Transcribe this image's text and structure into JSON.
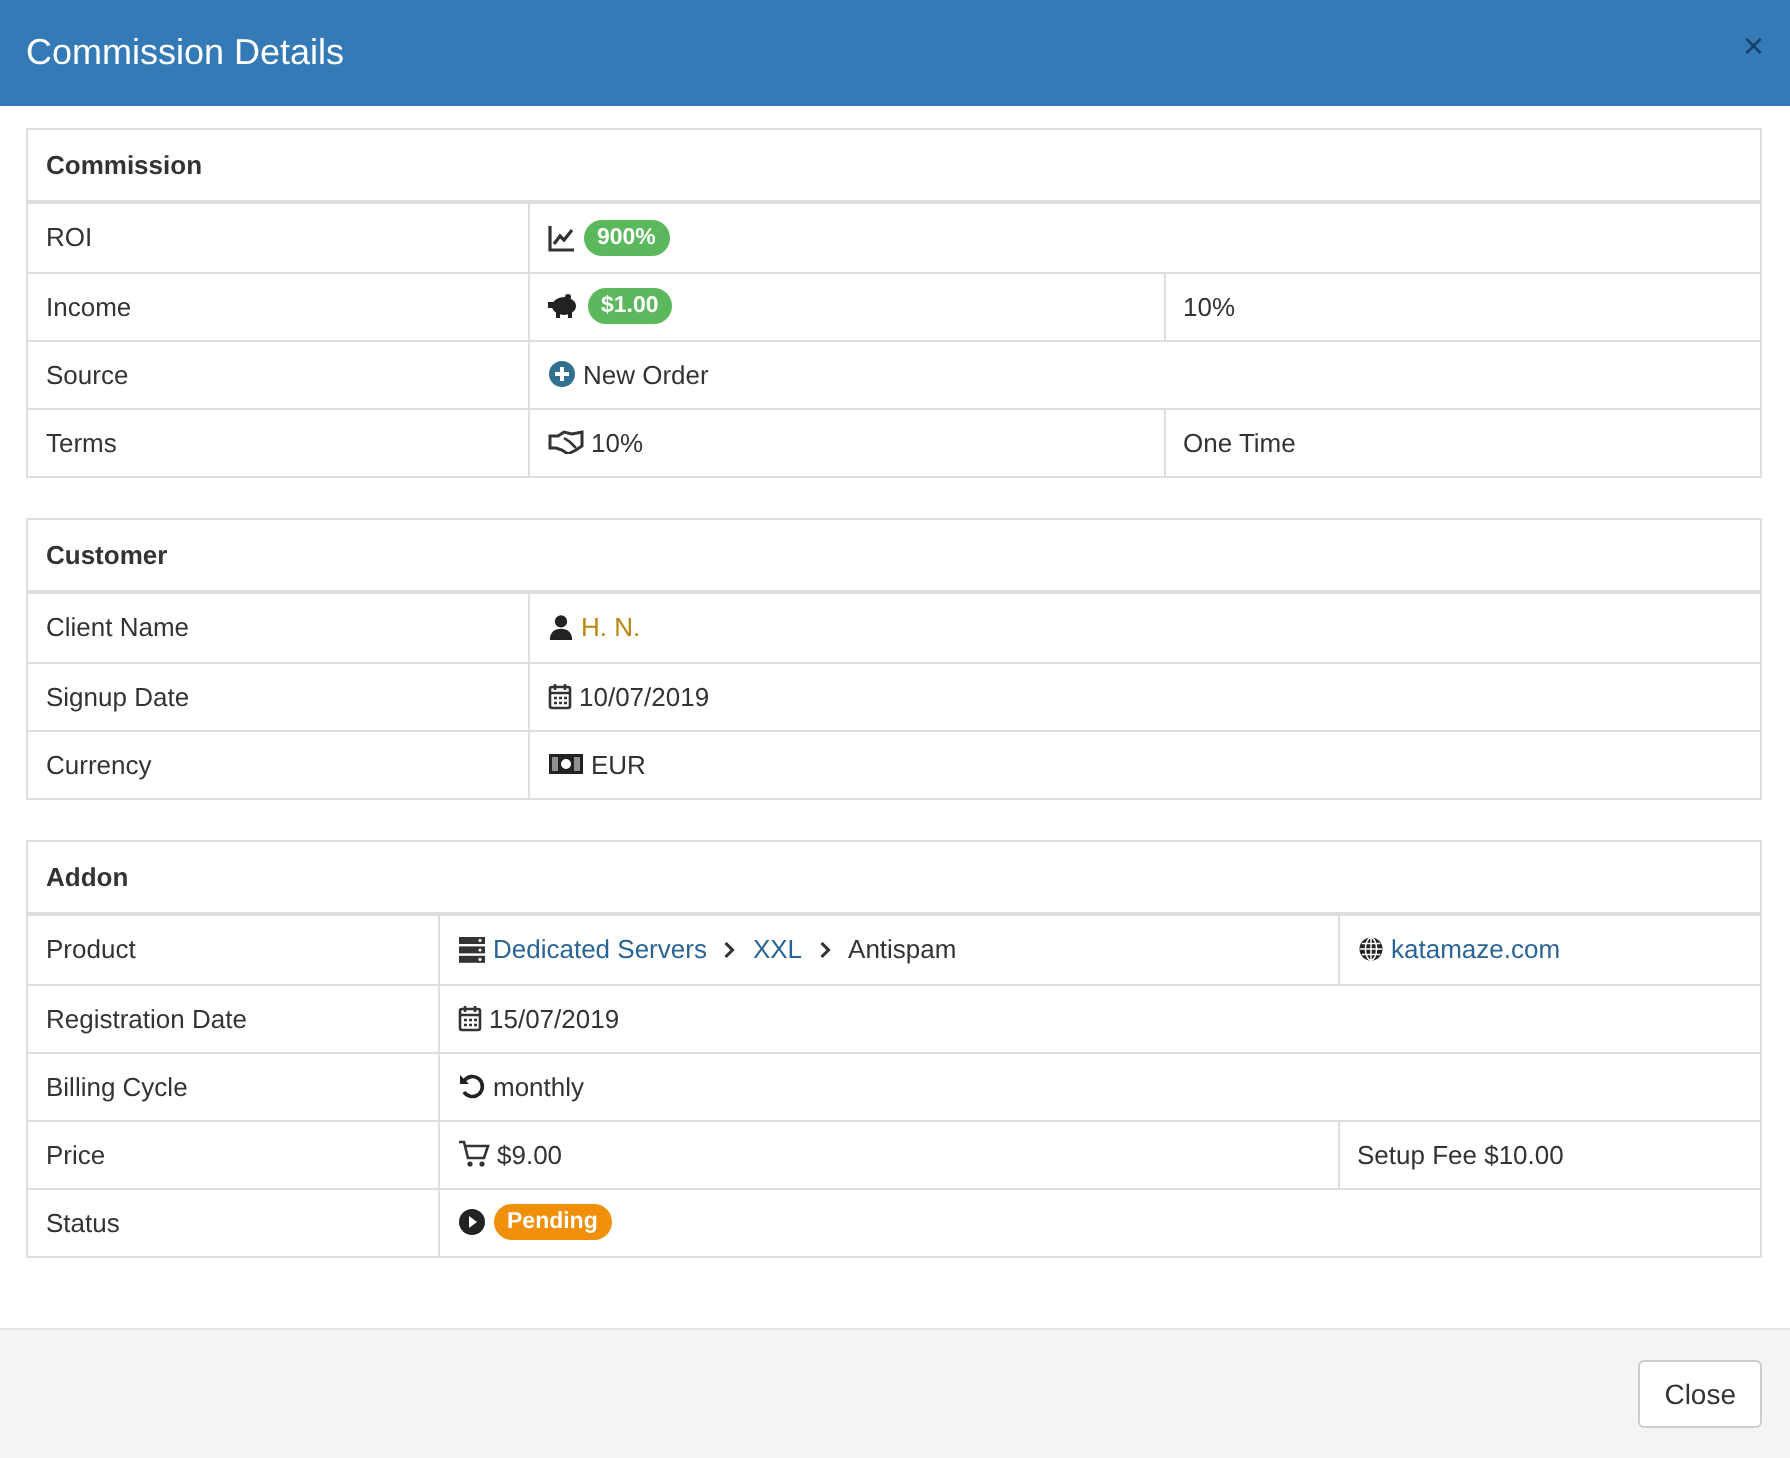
{
  "modal": {
    "title": "Commission Details",
    "close_glyph": "×"
  },
  "sections": [
    {
      "title": "Commission",
      "rows": [
        {
          "label": "ROI",
          "cells": [
            {
              "colspan": 2,
              "parts": [
                {
                  "kind": "badge",
                  "text": "900%",
                  "color": "#5cb85c"
                }
              ]
            }
          ]
        },
        {
          "label": "Income",
          "cells": [
            {
              "parts": [
                {
                  "kind": "badge",
                  "text": "$1.00",
                  "color": "#5cb85c"
                }
              ]
            },
            {
              "parts": [
                {
                  "kind": "text",
                  "text": "10%"
                }
              ]
            }
          ]
        },
        {
          "label": "Source",
          "cells": [
            {
              "colspan": 2,
              "parts": [
                {
                  "kind": "text",
                  "text": "New Order"
                }
              ]
            }
          ]
        },
        {
          "label": "Terms",
          "cells": [
            {
              "parts": [
                {
                  "kind": "text",
                  "text": "10%"
                }
              ]
            },
            {
              "parts": [
                {
                  "kind": "text",
                  "text": "One Time"
                }
              ]
            }
          ]
        }
      ]
    },
    {
      "title": "Customer",
      "rows": [
        {
          "label": "Client Name",
          "cells": [
            {
              "colspan": 2,
              "parts": [
                {
                  "kind": "link",
                  "text": "H. N.",
                  "color": "#b8860b"
                }
              ]
            }
          ]
        },
        {
          "label": "Signup Date",
          "cells": [
            {
              "colspan": 2,
              "parts": [
                {
                  "kind": "text",
                  "text": "10/07/2019"
                }
              ]
            }
          ]
        },
        {
          "label": "Currency",
          "cells": [
            {
              "colspan": 2,
              "parts": [
                {
                  "kind": "text",
                  "text": "EUR"
                }
              ]
            }
          ]
        }
      ]
    },
    {
      "title": "Addon",
      "rows": [
        {
          "label": "Product",
          "cells": [
            {
              "parts": [
                {
                  "kind": "link",
                  "text": "Dedicated Servers",
                  "color": "#2a6496"
                },
                {
                  "kind": "chevron"
                },
                {
                  "kind": "link",
                  "text": "XXL",
                  "color": "#2a6496"
                },
                {
                  "kind": "chevron"
                },
                {
                  "kind": "text",
                  "text": "Antispam"
                }
              ]
            },
            {
              "parts": [
                {
                  "kind": "link",
                  "text": "katamaze.com",
                  "color": "#2a6496"
                }
              ]
            }
          ]
        },
        {
          "label": "Registration Date",
          "cells": [
            {
              "colspan": 2,
              "parts": [
                {
                  "kind": "text",
                  "text": "15/07/2019"
                }
              ]
            }
          ]
        },
        {
          "label": "Billing Cycle",
          "cells": [
            {
              "colspan": 2,
              "parts": [
                {
                  "kind": "text",
                  "text": "monthly"
                }
              ]
            }
          ]
        },
        {
          "label": "Price",
          "cells": [
            {
              "parts": [
                {
                  "kind": "text",
                  "text": "$9.00"
                }
              ]
            },
            {
              "parts": [
                {
                  "kind": "text",
                  "text": "Setup Fee $10.00"
                }
              ]
            }
          ]
        },
        {
          "label": "Status",
          "cells": [
            {
              "colspan": 2,
              "parts": [
                {
                  "kind": "badge",
                  "text": "Pending",
                  "color": "#f0900a"
                }
              ]
            }
          ]
        }
      ]
    }
  ],
  "footer": {
    "buttons": [
      "Close"
    ]
  }
}
